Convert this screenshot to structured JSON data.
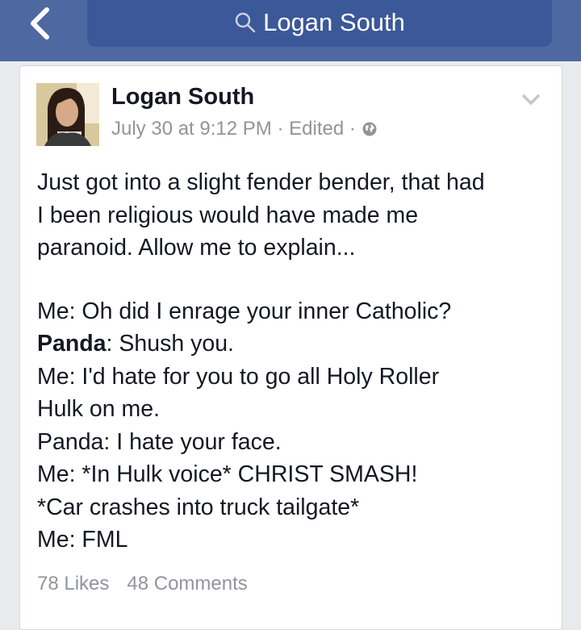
{
  "nav": {
    "search_text": "Logan South",
    "back_icon": "chevron-left-icon",
    "search_icon": "search-icon",
    "bar_color": "#4e69a2"
  },
  "post": {
    "author": "Logan South",
    "date": "July 30 at 9:12 PM",
    "separator": "·",
    "edited": "Edited",
    "privacy_icon": "globe-icon",
    "intro": [
      "Just got into a slight fender bender, that had",
      "I been religious would have made me",
      "paranoid. Allow me to explain..."
    ],
    "dialogue": [
      {
        "text": "Me: Oh did I enrage your inner Catholic?"
      },
      {
        "speaker": "Panda",
        "text": ": Shush you."
      },
      {
        "text": "Me: I'd hate for you to go all Holy Roller"
      },
      {
        "text": "Hulk on me."
      },
      {
        "text": "Panda: I hate your face."
      },
      {
        "text": "Me: *In Hulk voice* CHRIST SMASH!"
      },
      {
        "text": "*Car crashes into truck tailgate*"
      },
      {
        "text": "Me: FML"
      }
    ],
    "likes": "78 Likes",
    "comments": "48 Comments"
  }
}
